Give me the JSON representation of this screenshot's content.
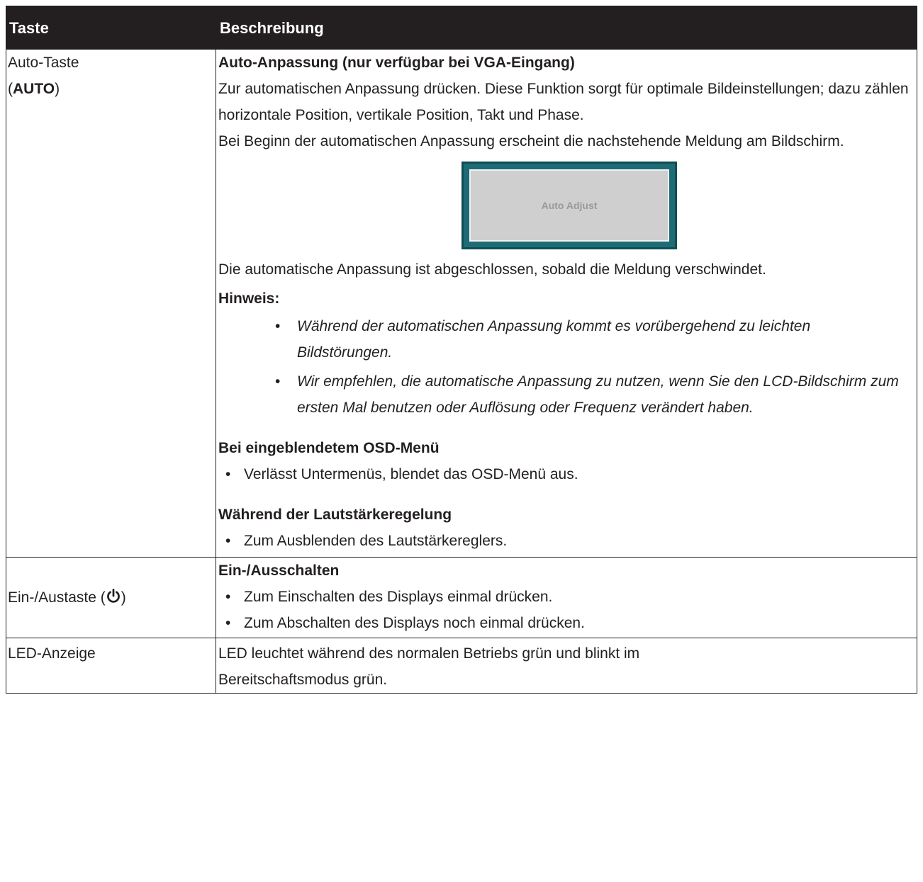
{
  "header": {
    "col1": "Taste",
    "col2": "Beschreibung"
  },
  "auto_row": {
    "key_line1": "Auto-Taste",
    "key_open": "(",
    "key_bold": "AUTO",
    "key_close": ")",
    "title": "Auto-Anpassung (nur verfügbar bei VGA-Eingang)",
    "p1": "Zur automatischen Anpassung drücken. Diese Funktion sorgt für optimale Bildeinstellungen; dazu zählen horizontale Position, vertikale Position, Takt und Phase.",
    "p2": "Bei Beginn der automatischen Anpassung erscheint die nachstehende Meldung am Bildschirm.",
    "osd_message": "Auto Adjust",
    "p3": "Die automatische Anpassung ist abgeschlossen, sobald die Meldung verschwindet.",
    "note_label": "Hinweis:",
    "notes": [
      "Während der automatischen Anpassung kommt es vorübergehend zu leichten Bildstörungen.",
      "Wir empfehlen, die automatische Anpassung zu nutzen, wenn Sie den LCD-Bildschirm zum ersten Mal benutzen oder Auflösung oder Frequenz verändert haben."
    ],
    "osd_heading": "Bei eingeblendetem OSD-Menü",
    "osd_bullet": "Verlässt Untermenüs, blendet das OSD-Menü aus.",
    "volume_heading": "Während der Lautstärkeregelung",
    "volume_bullet": "Zum Ausblenden des Lautstärkereglers."
  },
  "power_row": {
    "key_text": "Ein-/Austaste (",
    "key_close": ")",
    "icon": "power-icon",
    "title": "Ein-/Ausschalten",
    "bullets": [
      "Zum Einschalten des Displays einmal drücken.",
      "Zum Abschalten des Displays noch einmal drücken."
    ]
  },
  "led_row": {
    "key_text": "LED-Anzeige",
    "desc": "LED leuchtet während des normalen Betriebs grün und blinkt im Bereitschaftsmodus grün."
  },
  "colors": {
    "header_bg": "#231f20",
    "osd_frame": "#1d6b75",
    "osd_panel": "#cfcfcf"
  }
}
